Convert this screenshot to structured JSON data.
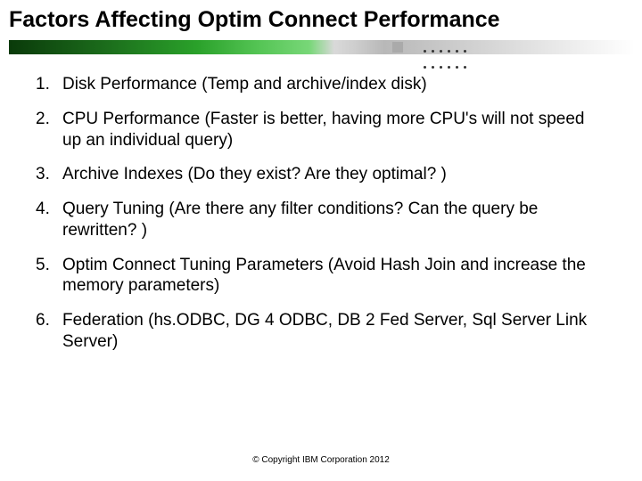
{
  "title": "Factors Affecting Optim Connect Performance",
  "items": [
    "Disk Performance (Temp and archive/index disk)",
    "CPU Performance (Faster is better, having more CPU's will not speed up an individual query)",
    "Archive Indexes (Do they exist? Are they optimal? )",
    "Query Tuning (Are there any filter conditions? Can the query be rewritten? )",
    "Optim Connect Tuning Parameters (Avoid Hash Join and increase the memory parameters)",
    "Federation (hs.ODBC, DG 4 ODBC, DB 2 Fed Server, Sql Server Link Server)"
  ],
  "copyright": "© Copyright IBM Corporation 2012"
}
